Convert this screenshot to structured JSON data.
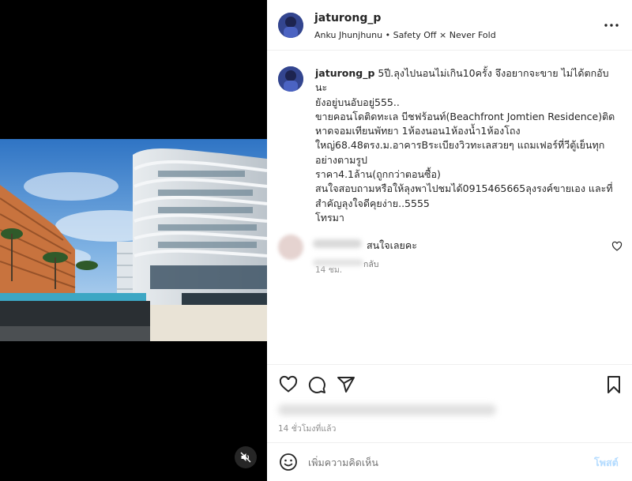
{
  "colors": {
    "link_disabled": "#b3dbff",
    "text_primary": "#262626",
    "text_secondary": "#8e8e8e",
    "media_bg": "#000000"
  },
  "media": {
    "mute_icon": "speaker-muted-icon"
  },
  "header": {
    "username": "jaturong_p",
    "subtitle": "Anku Jhunjhunu • Safety Off × Never Fold",
    "more_icon": "ellipsis-icon"
  },
  "caption": {
    "username": "jaturong_p",
    "text": " 5ปี.ลุงไปนอนไม่เกิน10ครั้ง จึงอยากจะขาย ไม่ได้ตกอับนะ\nยังอยู่บนอับอยู่555..\nขายคอนโดติดทะเล บีชฟร้อนท์(Beachfront Jomtien Residence)ติด\nหาดจอมเทียนพัทยา 1ห้องนอน1ห้องน้ำ1ห้องโถง\nใหญ่68.48ตรง.ม.อาคารBระเบียงวิวทะเลสวยๆ แถมเฟอร์ที่วีตู้เย็นทุก\nอย่างตามรูป\nราคา4.1ล้าน(ถูกกว่าตอนซื้อ)\nสนใจสอบถามหรือให้ลุงพาไปชมได้0915465665ลุงรงค์ขายเอง และที่\nสำคัญลุงใจดีคุยง่าย..5555\nโทรมา",
    "time": "14 ชม."
  },
  "comment": {
    "text": "สนใจเลยคะ",
    "reply_label": "กลับ"
  },
  "actions": {
    "like_icon": "heart-outline-icon",
    "comment_icon": "comment-bubble-icon",
    "share_icon": "paper-plane-icon",
    "save_icon": "bookmark-icon",
    "time": "14 ชั่วโมงที่แล้ว"
  },
  "composer": {
    "placeholder": "เพิ่มความคิดเห็น",
    "post_label": "โพสต์",
    "emoji_icon": "emoji-smile-icon"
  }
}
